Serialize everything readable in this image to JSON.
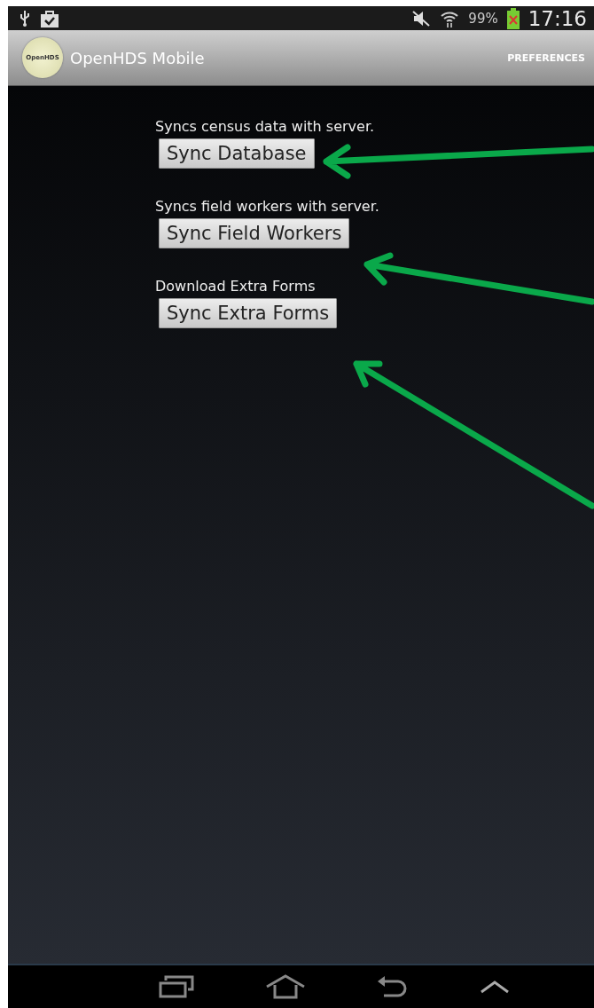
{
  "status_bar": {
    "battery": "99%",
    "time": "17:16"
  },
  "app_bar": {
    "logo_text": "OpenHDS",
    "title": "OpenHDS Mobile",
    "action": "PREFERENCES"
  },
  "sections": [
    {
      "description": "Syncs census data with server.",
      "button": "Sync Database"
    },
    {
      "description": "Syncs field workers with server.",
      "button": "Sync Field Workers"
    },
    {
      "description": "Download Extra Forms",
      "button": "Sync Extra Forms"
    }
  ]
}
